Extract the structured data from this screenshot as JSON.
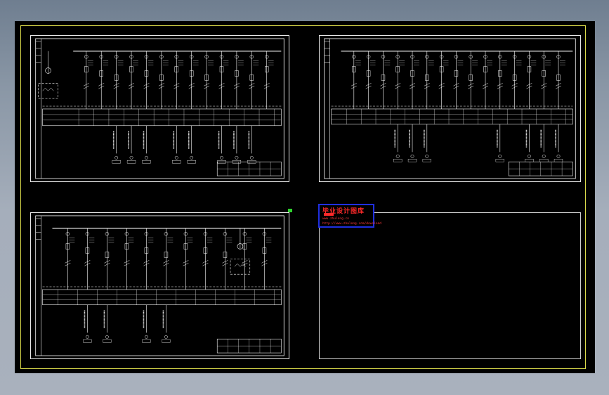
{
  "app": {
    "background": "#000000",
    "frame_color": "#d9d94a",
    "line_color": "#ffffff"
  },
  "sheets": [
    {
      "id": "sheet-1",
      "label": "electrical-single-line-diagram-1"
    },
    {
      "id": "sheet-2",
      "label": "electrical-single-line-diagram-2"
    },
    {
      "id": "sheet-3",
      "label": "electrical-single-line-diagram-3"
    },
    {
      "id": "sheet-4",
      "label": "blank-sheet"
    }
  ],
  "watermark": {
    "title": "毕业设计图库",
    "line1": "www.zhulong.cn",
    "line2": "http://www.zhulong.com/download",
    "title_color": "#ff2a2a",
    "border_color": "#1f2fe0"
  }
}
